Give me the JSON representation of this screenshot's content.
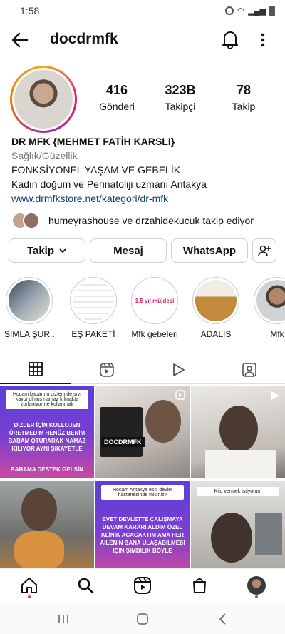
{
  "status": {
    "time": "1:58"
  },
  "header": {
    "username": "docdrmfk"
  },
  "stats": [
    {
      "value": "416",
      "label": "Gönderi"
    },
    {
      "value": "323B",
      "label": "Takipçi"
    },
    {
      "value": "78",
      "label": "Takip"
    }
  ],
  "bio": {
    "name": "DR MFK  {MEHMET FATİH KARSLI}",
    "category": "Sağlık/Güzellik",
    "line1": "FONKSİYONEL YAŞAM VE GEBELİK",
    "line2": "Kadın doğum ve Perinatoliji uzmanı Antakya",
    "link": "www.drmfkstore.net/kategori/dr-mfk"
  },
  "followed_by": "humeyrashouse ve drzahidekucuk takip ediyor",
  "buttons": {
    "follow": "Takip",
    "message": "Mesaj",
    "whatsapp": "WhatsApp"
  },
  "highlights": [
    {
      "label": "SİMLA ŞUR..."
    },
    {
      "label": "EŞ PAKETİ"
    },
    {
      "label": "Mfk gebeleri",
      "badge": "1.5 yıl müjdesi"
    },
    {
      "label": "ADALİS"
    },
    {
      "label": "Mfk"
    }
  ],
  "posts": {
    "p1": {
      "caption": "Hocam babamın dizlerinde sıvı kaybı olmuş namaz kılmakta zorlanıyor ne kullanmalı",
      "text": "DİZLER İÇİN KOLLOJEN ÜRETMEDİM HENÜZ BENİM BABAM OTURARAK NAMAZ KILIYOR AYNI ŞİKAYETLE",
      "footer": "BABAMA DESTEK GELSİN"
    },
    "p2": {
      "tag": "DOCDRMFK"
    },
    "p5": {
      "caption": "Hocam Antakya eski devlet hastanesinde misiniz?",
      "text": "EVET DEVLETTE ÇALIŞMAYA DEVAM KARARI ALDIM ÖZEL KLİNİK AÇACAKTIM AMA HER AİLENİN BANA ULAŞABİLMESİ İÇİN ŞİMDİLİK BÖYLE"
    },
    "p6": {
      "caption": "Kilo vermek istiyorum"
    }
  }
}
